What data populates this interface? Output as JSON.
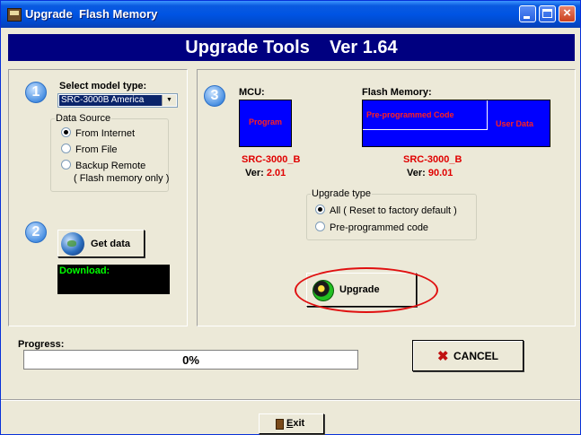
{
  "window": {
    "title": "Upgrade  Flash Memory"
  },
  "header": {
    "title": "Upgrade Tools    Ver 1.64"
  },
  "steps": [
    "1",
    "2",
    "3"
  ],
  "model": {
    "label": "Select model type:",
    "selected": "SRC-3000B America"
  },
  "data_source": {
    "title": "Data Source",
    "options": [
      "From Internet",
      "From File",
      "Backup Remote",
      "( Flash memory only )"
    ],
    "selected": "From Internet"
  },
  "get_data": {
    "label": "Get data"
  },
  "download": {
    "label": "Download:"
  },
  "mcu": {
    "label": "MCU:",
    "program": "Program",
    "model": "SRC-3000_B",
    "ver_label": "Ver:",
    "ver_value": "2.01"
  },
  "flash": {
    "label": "Flash Memory:",
    "preprogrammed": "Pre-programmed Code",
    "user_data": "User Data",
    "model": "SRC-3000_B",
    "ver_label": "Ver:",
    "ver_value": "90.01"
  },
  "upgrade_type": {
    "title": "Upgrade type",
    "options": [
      "All ( Reset to factory default )",
      "Pre-programmed code"
    ],
    "selected": "All ( Reset to factory default )"
  },
  "upgrade": {
    "label": "Upgrade"
  },
  "progress": {
    "label": "Progress:",
    "text": "0%",
    "value": 0
  },
  "cancel": {
    "icon": "✖",
    "label": "CANCEL"
  },
  "exit": {
    "label": "Exit"
  },
  "colors": {
    "accent": "#000080",
    "highlight_red": "#e01010",
    "memory_blue": "#0000ff",
    "download_green": "#00ff00"
  }
}
